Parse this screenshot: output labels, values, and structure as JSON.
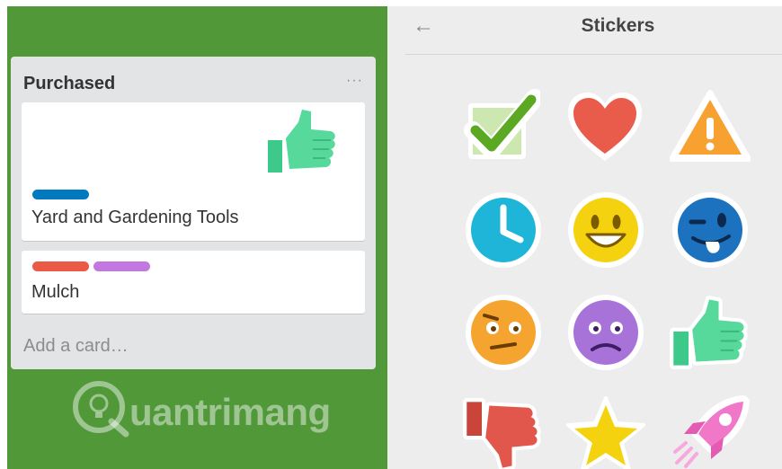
{
  "list": {
    "title": "Purchased",
    "menu_label": "···",
    "cards": [
      {
        "title": "Yard and Gardening Tools",
        "labels": [
          "#0079bf"
        ],
        "sticker": "thumbs-up-sticker"
      },
      {
        "title": "Mulch",
        "labels": [
          "#eb5a46",
          "#c377e0"
        ]
      }
    ],
    "add_card": "Add a card…"
  },
  "panel": {
    "title": "Stickers",
    "back_icon": "←",
    "stickers": [
      "check",
      "heart",
      "warning",
      "clock",
      "smile",
      "wink",
      "confused",
      "sad",
      "thumbs-up",
      "thumbs-down",
      "star",
      "rocket"
    ]
  },
  "watermark": {
    "text": "uantrimang"
  },
  "colors": {
    "board": "#519839",
    "list": "#e2e4e6",
    "panel": "#ededed"
  }
}
